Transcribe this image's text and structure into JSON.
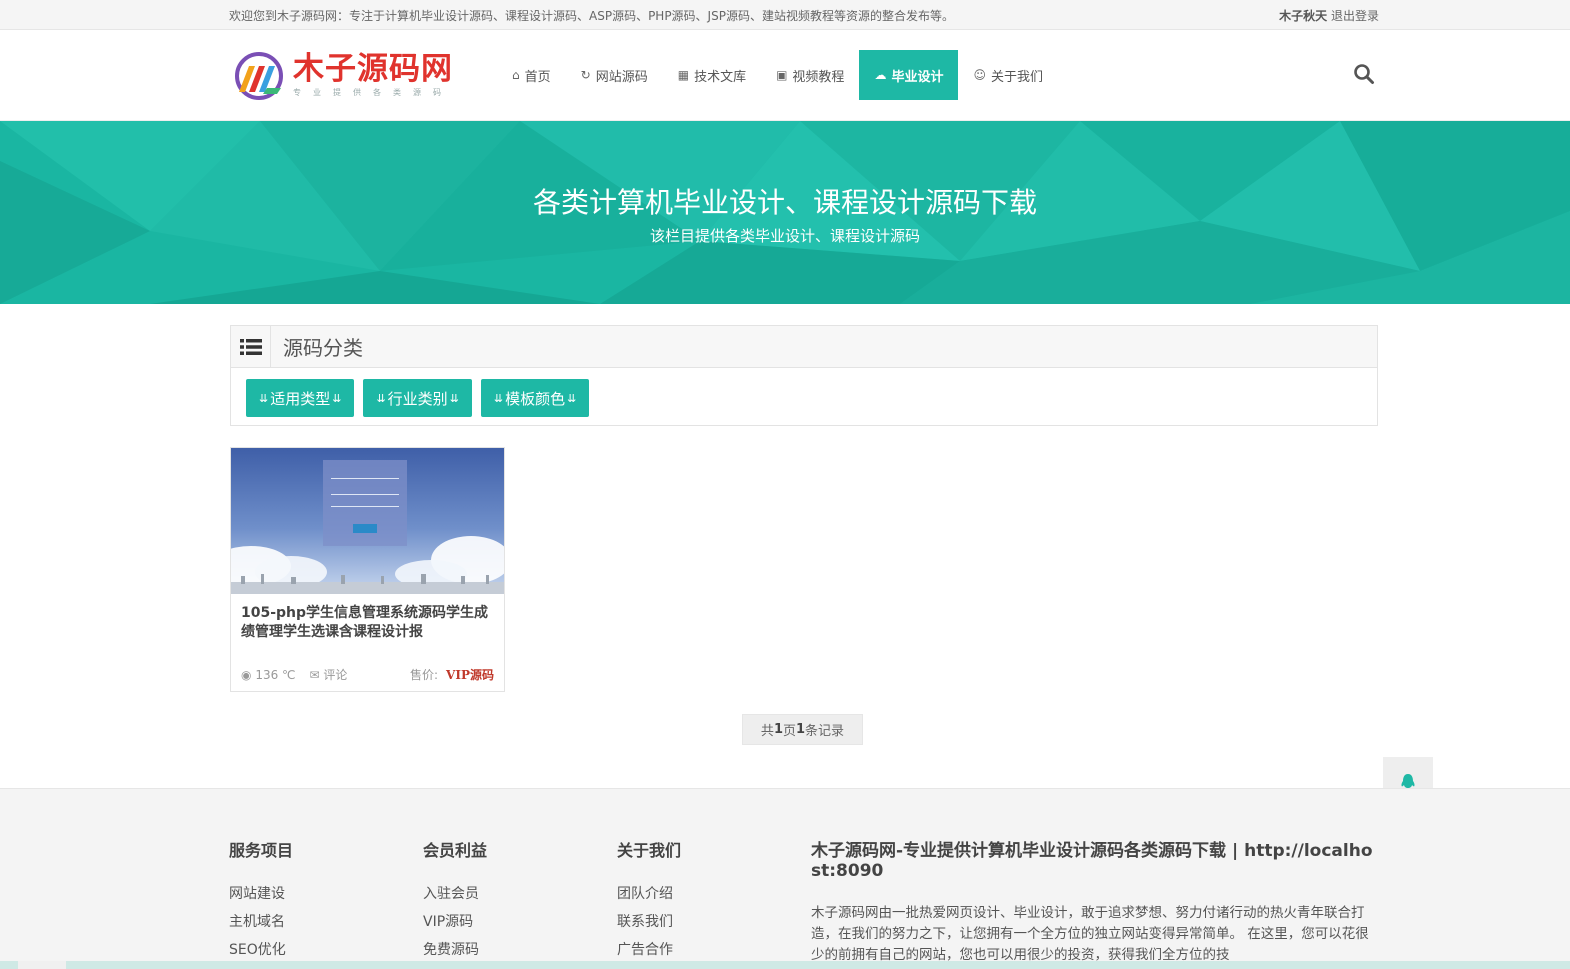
{
  "topbar": {
    "welcome": "欢迎您到木子源码网：专注于计算机毕业设计源码、课程设计源码、ASP源码、PHP源码、JSP源码、建站视频教程等资源的整合发布等。",
    "username": "木子秋天",
    "logout": "退出登录"
  },
  "logo": {
    "title": "木子源码网",
    "subtitle": "专业提供各类源码"
  },
  "nav": {
    "items": [
      {
        "label": "首页",
        "icon": "home-icon"
      },
      {
        "label": "网站源码",
        "icon": "refresh-icon"
      },
      {
        "label": "技术文库",
        "icon": "document-icon"
      },
      {
        "label": "视频教程",
        "icon": "film-icon"
      },
      {
        "label": "毕业设计",
        "icon": "cloud-download-icon",
        "active": true
      },
      {
        "label": "关于我们",
        "icon": "smile-icon"
      }
    ]
  },
  "banner": {
    "title": "各类计算机毕业设计、课程设计源码下载",
    "subtitle": "该栏目提供各类毕业设计、课程设计源码"
  },
  "category": {
    "title": "源码分类",
    "filters": [
      "适用类型",
      "行业类别",
      "模板颜色"
    ]
  },
  "products": [
    {
      "title": "105-php学生信息管理系统源码学生成绩管理学生选课含课程设计报",
      "views": "136 ℃",
      "comments": "评论",
      "price_label": "售价:",
      "price_value": "VIP源码"
    }
  ],
  "pager": {
    "prefix": "共 ",
    "pages": "1",
    "mid": "页",
    "records": "1",
    "suffix": "条记录"
  },
  "footer": {
    "columns": [
      {
        "title": "服务项目",
        "links": [
          "网站建设",
          "主机域名",
          "SEO优化"
        ]
      },
      {
        "title": "会员利益",
        "links": [
          "入驻会员",
          "VIP源码",
          "免费源码"
        ]
      },
      {
        "title": "关于我们",
        "links": [
          "团队介绍",
          "联系我们",
          "广告合作"
        ]
      }
    ],
    "about_title": "木子源码网-专业提供计算机毕业设计源码各类源码下载 | http://localhost:8090",
    "about_text": "木子源码网由一批热爱网页设计、毕业设计，敢于追求梦想、努力付诸行动的热火青年联合打造，在我们的努力之下，让您拥有一个全方位的独立网站变得异常简单。 在这里，您可以花很少的前拥有自己的网站，您也可以用很少的投资，获得我们全方位的技"
  },
  "colors": {
    "accent": "#1eb8a5",
    "logo_red": "#e0332d",
    "price_red": "#c0392b"
  }
}
